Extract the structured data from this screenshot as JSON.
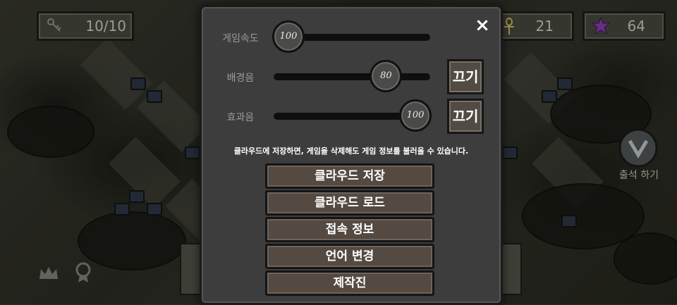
{
  "hud": {
    "keys": {
      "icon": "key-icon",
      "value": "10/10"
    },
    "ankh": {
      "icon": "ankh-icon",
      "value": "21"
    },
    "gem": {
      "icon": "purple-star-icon",
      "value": "64"
    }
  },
  "attendance": {
    "icon": "attendance-shield-icon",
    "label": "출석 하기"
  },
  "settings": {
    "close_icon": "×",
    "game_speed": {
      "label": "게임속도",
      "value": "100",
      "level": 100
    },
    "bgm": {
      "label": "배경음",
      "value": "80",
      "level": 80,
      "mute_label": "끄기"
    },
    "sfx": {
      "label": "효과음",
      "value": "100",
      "level": 100,
      "mute_label": "끄기"
    },
    "cloud_info": "클라우드에 저장하면, 게임을 삭제해도 게임 정보를 불러올 수 있습니다.",
    "buttons": [
      "클라우드 저장",
      "클라우드 로드",
      "접속 정보",
      "언어 변경",
      "제작진"
    ]
  },
  "colors": {
    "panel": "#3d3d3d",
    "button": "#544a42",
    "gem": "#8e3fbf",
    "ankh": "#d8c46a"
  }
}
